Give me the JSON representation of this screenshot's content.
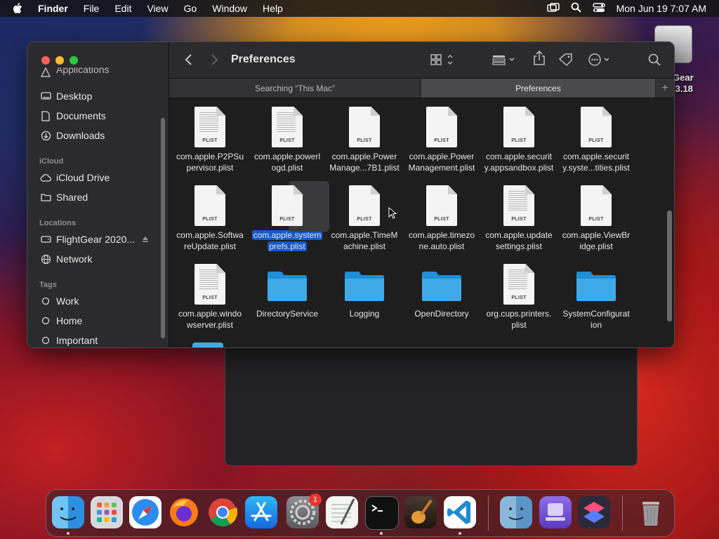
{
  "menubar": {
    "app": "Finder",
    "items": [
      "File",
      "Edit",
      "View",
      "Go",
      "Window",
      "Help"
    ],
    "clock": "Mon Jun 19  7:07 AM"
  },
  "desktop": {
    "drive_label_line1": "Gear",
    "drive_label_line2": ".3.18"
  },
  "finder": {
    "title": "Preferences",
    "tabs": [
      {
        "label": "Searching “This Mac”",
        "active": false
      },
      {
        "label": "Preferences",
        "active": true
      }
    ],
    "sidebar": {
      "partial_top": "Applications",
      "favorites": [
        {
          "label": "Desktop",
          "icon": "desktop-icon"
        },
        {
          "label": "Documents",
          "icon": "document-icon"
        },
        {
          "label": "Downloads",
          "icon": "download-icon"
        }
      ],
      "icloud_heading": "iCloud",
      "icloud": [
        {
          "label": "iCloud Drive",
          "icon": "cloud-icon"
        },
        {
          "label": "Shared",
          "icon": "shared-folder-icon"
        }
      ],
      "locations_heading": "Locations",
      "locations": [
        {
          "label": "FlightGear 2020...",
          "icon": "disk-icon"
        },
        {
          "label": "Network",
          "icon": "globe-icon"
        }
      ],
      "tags_heading": "Tags",
      "tags": [
        {
          "label": "Work",
          "icon": "tag-circle-icon"
        },
        {
          "label": "Home",
          "icon": "tag-circle-icon"
        },
        {
          "label": "Important",
          "icon": "tag-circle-icon"
        }
      ]
    },
    "files": [
      {
        "name": "com.apple.P2PSu\npervisor.plist",
        "kind": "plist",
        "dense": true
      },
      {
        "name": "com.apple.powerl\nogd.plist",
        "kind": "plist",
        "dense": true
      },
      {
        "name": "com.apple.Power\nManage...7B1.plist",
        "kind": "plist",
        "dense": false
      },
      {
        "name": "com.apple.Power\nManagement.plist",
        "kind": "plist",
        "dense": false
      },
      {
        "name": "com.apple.securit\ny.appsandbox.plist",
        "kind": "plist",
        "dense": false
      },
      {
        "name": "com.apple.securit\ny.syste...tities.plist",
        "kind": "plist",
        "dense": false
      },
      {
        "name": "com.apple.Softwa\nreUpdate.plist",
        "kind": "plist",
        "dense": false
      },
      {
        "name": "com.apple.system\nprefs.plist",
        "kind": "plist",
        "dense": false,
        "selected": true
      },
      {
        "name": "com.apple.TimeM\nachine.plist",
        "kind": "plist",
        "dense": false
      },
      {
        "name": "com.apple.timezo\nne.auto.plist",
        "kind": "plist",
        "dense": false
      },
      {
        "name": "com.apple.update\nsettings.plist",
        "kind": "plist",
        "dense": true
      },
      {
        "name": "com.apple.ViewBr\nidge.plist",
        "kind": "plist",
        "dense": false
      },
      {
        "name": "com.apple.windo\nwserver.plist",
        "kind": "plist",
        "dense": true
      },
      {
        "name": "DirectoryService",
        "kind": "folder"
      },
      {
        "name": "Logging",
        "kind": "folder"
      },
      {
        "name": "OpenDirectory",
        "kind": "folder"
      },
      {
        "name": "org.cups.printers.\nplist",
        "kind": "plist",
        "dense": true
      },
      {
        "name": "SystemConfigurat\nion",
        "kind": "folder"
      }
    ],
    "plist_tag": "PLIST"
  },
  "dock": {
    "apps": [
      "finder-icon",
      "launchpad-icon",
      "safari-icon",
      "firefox-icon",
      "chrome-icon",
      "app-store-icon",
      "system-settings-icon",
      "textedit-icon",
      "terminal-icon",
      "garageband-icon",
      "vscode-icon"
    ],
    "recent": [
      "finder-folder-icon",
      "simulator-icon",
      "shortcuts-icon"
    ],
    "system_settings_badge": "1"
  },
  "colors": {
    "selection": "#1359c9",
    "folder": "#3fa9e8",
    "badge": "#e8352b"
  }
}
